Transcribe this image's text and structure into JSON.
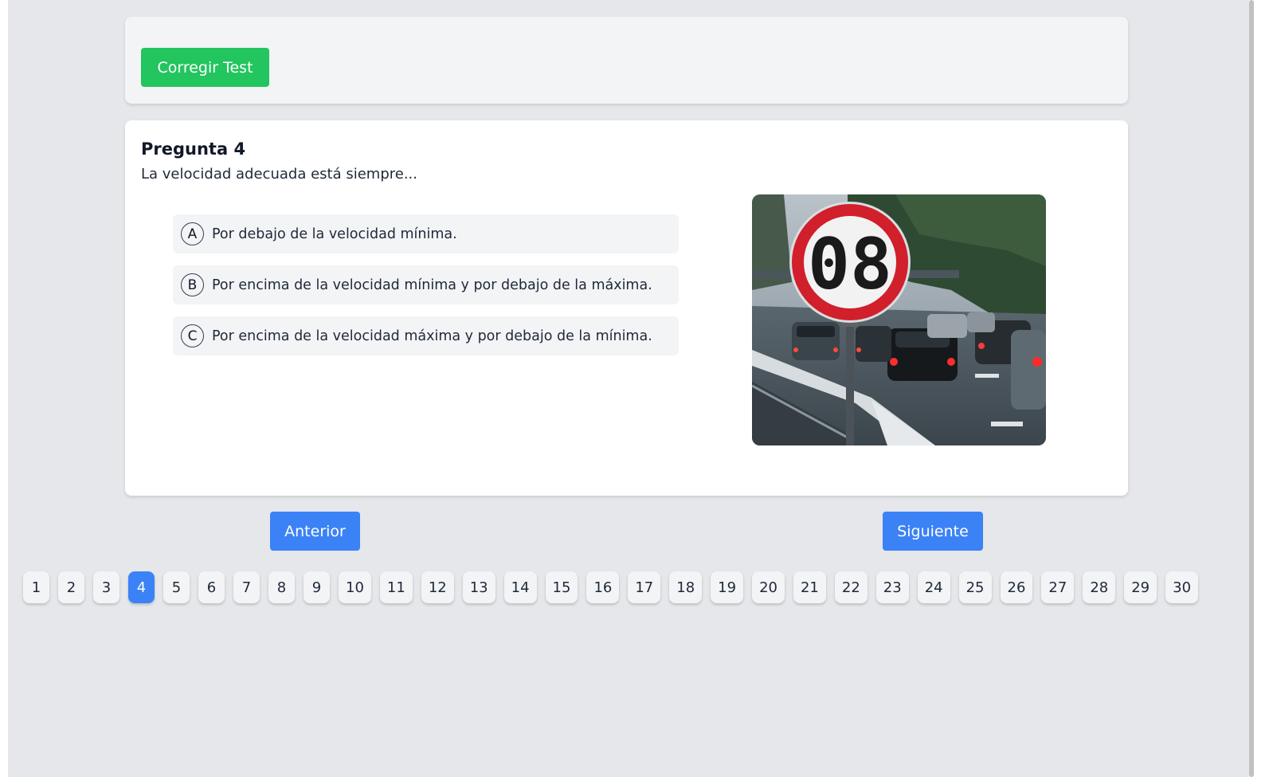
{
  "header": {
    "correct_label": "Corregir Test"
  },
  "question": {
    "title": "Pregunta 4",
    "text": "La velocidad adecuada está siempre...",
    "options": [
      {
        "letter": "A",
        "text": "Por debajo de la velocidad mínima."
      },
      {
        "letter": "B",
        "text": "Por encima de la velocidad mínima y por debajo de la máxima."
      },
      {
        "letter": "C",
        "text": "Por encima de la velocidad máxima y por debajo de la mínima."
      }
    ],
    "image": {
      "sign_text": "08"
    }
  },
  "navigation": {
    "prev_label": "Anterior",
    "next_label": "Siguiente"
  },
  "pager": {
    "current": 4,
    "pages": [
      "1",
      "2",
      "3",
      "4",
      "5",
      "6",
      "7",
      "8",
      "9",
      "10",
      "11",
      "12",
      "13",
      "14",
      "15",
      "16",
      "17",
      "18",
      "19",
      "20",
      "21",
      "22",
      "23",
      "24",
      "25",
      "26",
      "27",
      "28",
      "29",
      "30"
    ]
  },
  "colors": {
    "green": "#22c55e",
    "blue": "#3b82f6",
    "card": "#ffffff",
    "background": "#e5e7eb"
  }
}
